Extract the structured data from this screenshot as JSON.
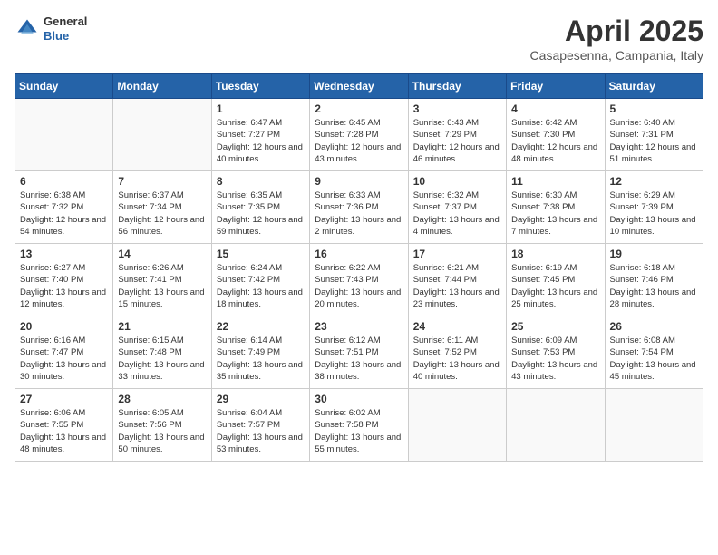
{
  "header": {
    "logo_general": "General",
    "logo_blue": "Blue",
    "month_title": "April 2025",
    "location": "Casapesenna, Campania, Italy"
  },
  "weekdays": [
    "Sunday",
    "Monday",
    "Tuesday",
    "Wednesday",
    "Thursday",
    "Friday",
    "Saturday"
  ],
  "weeks": [
    [
      {
        "day": "",
        "info": ""
      },
      {
        "day": "",
        "info": ""
      },
      {
        "day": "1",
        "info": "Sunrise: 6:47 AM\nSunset: 7:27 PM\nDaylight: 12 hours and 40 minutes."
      },
      {
        "day": "2",
        "info": "Sunrise: 6:45 AM\nSunset: 7:28 PM\nDaylight: 12 hours and 43 minutes."
      },
      {
        "day": "3",
        "info": "Sunrise: 6:43 AM\nSunset: 7:29 PM\nDaylight: 12 hours and 46 minutes."
      },
      {
        "day": "4",
        "info": "Sunrise: 6:42 AM\nSunset: 7:30 PM\nDaylight: 12 hours and 48 minutes."
      },
      {
        "day": "5",
        "info": "Sunrise: 6:40 AM\nSunset: 7:31 PM\nDaylight: 12 hours and 51 minutes."
      }
    ],
    [
      {
        "day": "6",
        "info": "Sunrise: 6:38 AM\nSunset: 7:32 PM\nDaylight: 12 hours and 54 minutes."
      },
      {
        "day": "7",
        "info": "Sunrise: 6:37 AM\nSunset: 7:34 PM\nDaylight: 12 hours and 56 minutes."
      },
      {
        "day": "8",
        "info": "Sunrise: 6:35 AM\nSunset: 7:35 PM\nDaylight: 12 hours and 59 minutes."
      },
      {
        "day": "9",
        "info": "Sunrise: 6:33 AM\nSunset: 7:36 PM\nDaylight: 13 hours and 2 minutes."
      },
      {
        "day": "10",
        "info": "Sunrise: 6:32 AM\nSunset: 7:37 PM\nDaylight: 13 hours and 4 minutes."
      },
      {
        "day": "11",
        "info": "Sunrise: 6:30 AM\nSunset: 7:38 PM\nDaylight: 13 hours and 7 minutes."
      },
      {
        "day": "12",
        "info": "Sunrise: 6:29 AM\nSunset: 7:39 PM\nDaylight: 13 hours and 10 minutes."
      }
    ],
    [
      {
        "day": "13",
        "info": "Sunrise: 6:27 AM\nSunset: 7:40 PM\nDaylight: 13 hours and 12 minutes."
      },
      {
        "day": "14",
        "info": "Sunrise: 6:26 AM\nSunset: 7:41 PM\nDaylight: 13 hours and 15 minutes."
      },
      {
        "day": "15",
        "info": "Sunrise: 6:24 AM\nSunset: 7:42 PM\nDaylight: 13 hours and 18 minutes."
      },
      {
        "day": "16",
        "info": "Sunrise: 6:22 AM\nSunset: 7:43 PM\nDaylight: 13 hours and 20 minutes."
      },
      {
        "day": "17",
        "info": "Sunrise: 6:21 AM\nSunset: 7:44 PM\nDaylight: 13 hours and 23 minutes."
      },
      {
        "day": "18",
        "info": "Sunrise: 6:19 AM\nSunset: 7:45 PM\nDaylight: 13 hours and 25 minutes."
      },
      {
        "day": "19",
        "info": "Sunrise: 6:18 AM\nSunset: 7:46 PM\nDaylight: 13 hours and 28 minutes."
      }
    ],
    [
      {
        "day": "20",
        "info": "Sunrise: 6:16 AM\nSunset: 7:47 PM\nDaylight: 13 hours and 30 minutes."
      },
      {
        "day": "21",
        "info": "Sunrise: 6:15 AM\nSunset: 7:48 PM\nDaylight: 13 hours and 33 minutes."
      },
      {
        "day": "22",
        "info": "Sunrise: 6:14 AM\nSunset: 7:49 PM\nDaylight: 13 hours and 35 minutes."
      },
      {
        "day": "23",
        "info": "Sunrise: 6:12 AM\nSunset: 7:51 PM\nDaylight: 13 hours and 38 minutes."
      },
      {
        "day": "24",
        "info": "Sunrise: 6:11 AM\nSunset: 7:52 PM\nDaylight: 13 hours and 40 minutes."
      },
      {
        "day": "25",
        "info": "Sunrise: 6:09 AM\nSunset: 7:53 PM\nDaylight: 13 hours and 43 minutes."
      },
      {
        "day": "26",
        "info": "Sunrise: 6:08 AM\nSunset: 7:54 PM\nDaylight: 13 hours and 45 minutes."
      }
    ],
    [
      {
        "day": "27",
        "info": "Sunrise: 6:06 AM\nSunset: 7:55 PM\nDaylight: 13 hours and 48 minutes."
      },
      {
        "day": "28",
        "info": "Sunrise: 6:05 AM\nSunset: 7:56 PM\nDaylight: 13 hours and 50 minutes."
      },
      {
        "day": "29",
        "info": "Sunrise: 6:04 AM\nSunset: 7:57 PM\nDaylight: 13 hours and 53 minutes."
      },
      {
        "day": "30",
        "info": "Sunrise: 6:02 AM\nSunset: 7:58 PM\nDaylight: 13 hours and 55 minutes."
      },
      {
        "day": "",
        "info": ""
      },
      {
        "day": "",
        "info": ""
      },
      {
        "day": "",
        "info": ""
      }
    ]
  ]
}
